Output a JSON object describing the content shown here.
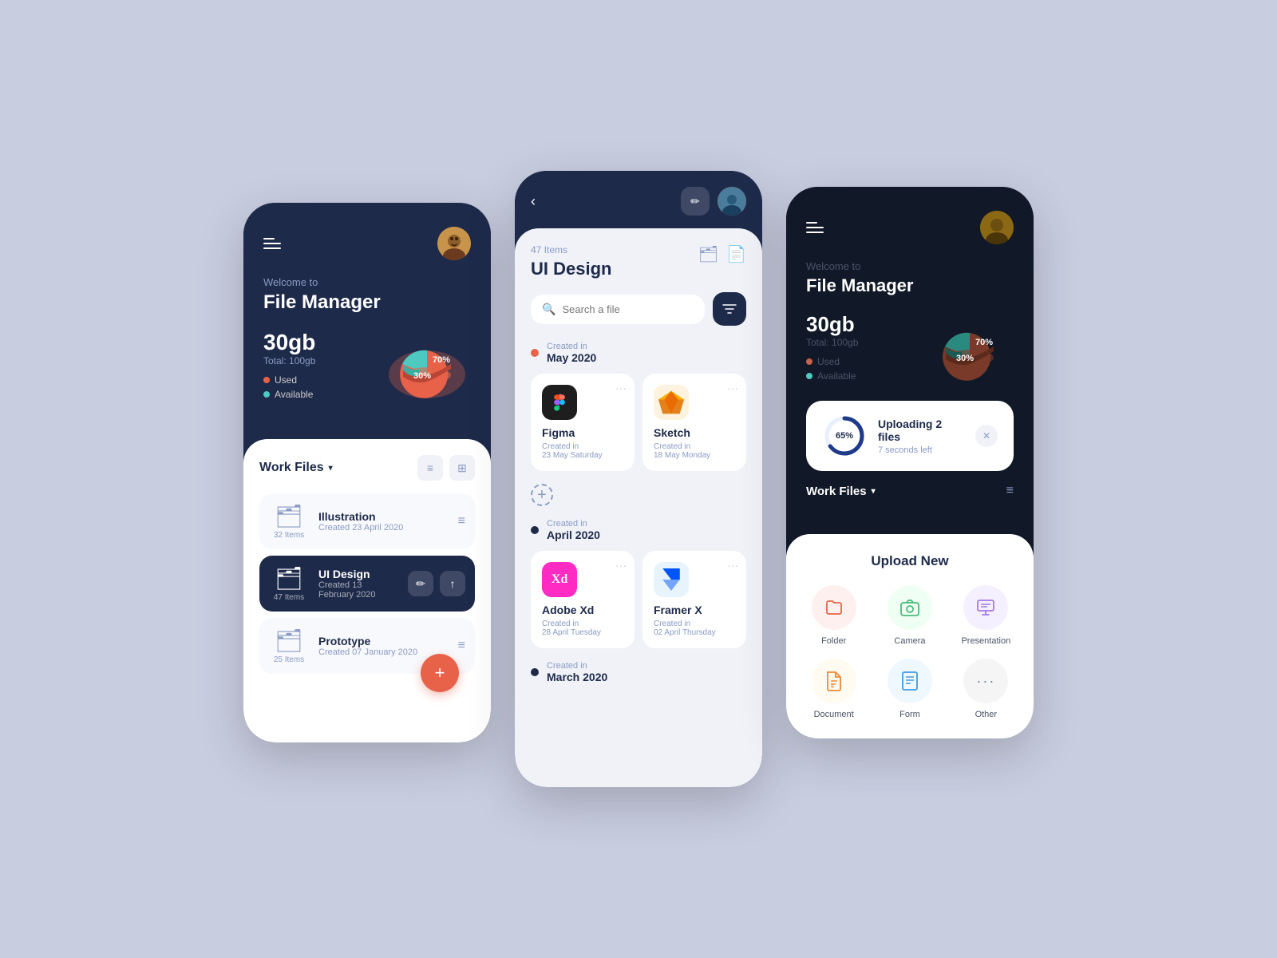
{
  "app": {
    "title": "File Manager",
    "welcome": "Welcome to"
  },
  "phone1": {
    "storage": {
      "used": "30gb",
      "total": "Total: 100gb",
      "used_pct": "70%",
      "avail_pct": "30%",
      "used_label": "Used",
      "avail_label": "Available"
    },
    "work_files_title": "Work Files",
    "files": [
      {
        "name": "Illustration",
        "date": "Created 23 April 2020",
        "items": "32 Items"
      },
      {
        "name": "UI Design",
        "date": "Created 13 February 2020",
        "items": "47 Items",
        "active": true
      },
      {
        "name": "Prototype",
        "date": "Created 07 January 2020",
        "items": "25 Items"
      }
    ],
    "fab_icon": "+"
  },
  "phone2": {
    "folder_name": "UI Design",
    "items_label": "47 Items",
    "search_placeholder": "Search a file",
    "sections": [
      {
        "created_label": "Created in",
        "month": "May 2020",
        "files": [
          {
            "name": "Figma",
            "created": "Created in",
            "date": "23 May Saturday",
            "icon_type": "figma"
          },
          {
            "name": "Sketch",
            "created": "Created in",
            "date": "18 May Monday",
            "icon_type": "sketch"
          }
        ]
      },
      {
        "created_label": "Created in",
        "month": "April 2020",
        "files": [
          {
            "name": "Adobe Xd",
            "created": "Created in",
            "date": "28 April Tuesday",
            "icon_type": "xd"
          },
          {
            "name": "Framer X",
            "created": "Created in",
            "date": "02 April Thursday",
            "icon_type": "framer"
          }
        ]
      },
      {
        "created_label": "Created in",
        "month": "March 2020",
        "files": []
      }
    ]
  },
  "phone3": {
    "storage": {
      "used": "30gb",
      "total": "Total: 100gb",
      "used_label": "Used",
      "avail_label": "Available"
    },
    "work_files_title": "Work Files",
    "upload": {
      "title": "Uploading 2 files",
      "subtitle": "7 seconds left",
      "progress": "65%",
      "progress_value": 65
    },
    "upload_panel": {
      "title": "Upload New",
      "items": [
        {
          "label": "Folder",
          "icon_class": "icon-pink",
          "icon": "📁"
        },
        {
          "label": "Camera",
          "icon_class": "icon-green",
          "icon": "📷"
        },
        {
          "label": "Presentation",
          "icon_class": "icon-purple",
          "icon": "📊"
        },
        {
          "label": "Document",
          "icon_class": "icon-yellow",
          "icon": "📄"
        },
        {
          "label": "Form",
          "icon_class": "icon-blue",
          "icon": "📋"
        },
        {
          "label": "Other",
          "icon_class": "icon-gray",
          "icon": "···"
        }
      ]
    }
  }
}
